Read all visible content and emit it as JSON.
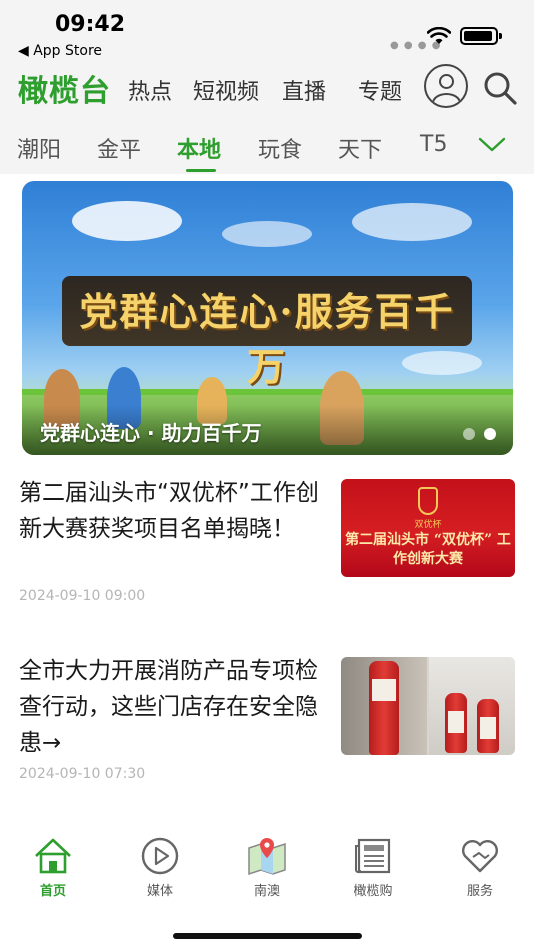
{
  "status_bar": {
    "time": "09:42",
    "back_label": "◀ App Store"
  },
  "header": {
    "brand": "橄榄台",
    "nav": [
      "热点",
      "短视频",
      "直播",
      "专题"
    ],
    "icons": {
      "profile": "user-icon",
      "search": "search-icon"
    },
    "brand_color": "#2e9e2e"
  },
  "channels": {
    "tabs": [
      "潮阳",
      "金平",
      "本地",
      "玩食",
      "天下",
      "T5"
    ],
    "active": "本地",
    "more_icon": "chevron-down-icon"
  },
  "banner": {
    "headline": "党群心连心·服务百千万",
    "caption": "党群心连心 · 助力百千万",
    "slide_count": 2,
    "active_slide": 2
  },
  "news": [
    {
      "title": "第二届汕头市“双优杯”工作创新大赛获奖项目名单揭晓！",
      "date": "2024-09-10 09:00",
      "thumb_logo_text": "双优杯",
      "thumb_title": "第二届汕头市 “双优杯” 工作创新大赛"
    },
    {
      "title": "全市大力开展消防产品专项检查行动，这些门店存在安全隐患→",
      "date": "2024-09-10 07:30"
    }
  ],
  "tabbar": {
    "items": [
      {
        "label": "首页",
        "icon": "home-icon"
      },
      {
        "label": "媒体",
        "icon": "play-icon"
      },
      {
        "label": "南澳",
        "icon": "map-icon"
      },
      {
        "label": "橄榄购",
        "icon": "newspaper-icon"
      },
      {
        "label": "服务",
        "icon": "heart-icon"
      }
    ],
    "active": "首页"
  }
}
